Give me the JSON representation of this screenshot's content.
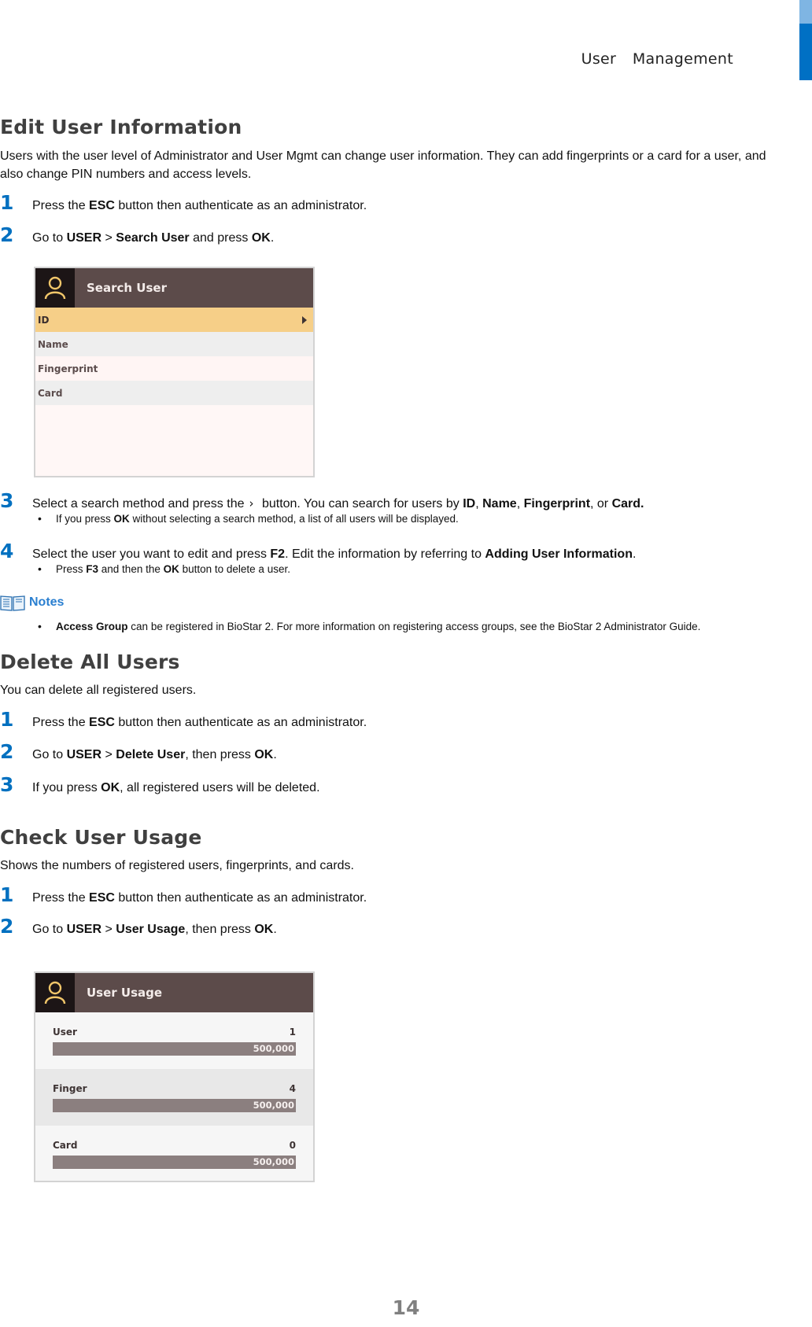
{
  "header": {
    "chapter_title": "User  Management",
    "tab_colors": {
      "light": "#7fb5e3",
      "dark": "#0070c4"
    }
  },
  "colors": {
    "step_number": "#0070c0",
    "heading": "#404040",
    "notes_label": "#2a7fd0"
  },
  "sections": {
    "edit": {
      "title": "Edit User Information",
      "intro_line1": "Users with the user level of Administrator and User Mgmt can change user information. They can add fingerprints or a card for a user, and",
      "intro_line2": "also change PIN numbers and access levels.",
      "steps": [
        {
          "num": "1",
          "pre": "Press the ",
          "b1": "ESC",
          "post": " button then authenticate as an administrator."
        },
        {
          "num": "2",
          "pre": "Go to ",
          "b1": "USER",
          "mid1": " > ",
          "b2": "Search User",
          "mid2": " and press ",
          "b3": "OK",
          "post": "."
        },
        {
          "num": "3",
          "pre": "Select a search method and press the",
          "chevron_icon": "chevron-right-icon",
          "chevron": "›",
          "mid1": " button. You can search for users by ",
          "b1": "ID",
          "c1": ", ",
          "b2": "Name",
          "c2": ", ",
          "b3": "Fingerprint",
          "c3": ", or ",
          "b4": "Card.",
          "bullet": {
            "pre": "If you press ",
            "b1": "OK",
            "post": " without selecting a search method, a list of all users will be displayed."
          }
        },
        {
          "num": "4",
          "pre": "Select the user you want to edit and press ",
          "b1": "F2",
          "mid1": ". Edit the information by referring to ",
          "b2": "Adding User Information",
          "post": ".",
          "bullet": {
            "pre": "Press ",
            "b1": "F3",
            "mid1": " and then the ",
            "b2": "OK",
            "post": " button to delete a user."
          }
        }
      ],
      "notes": {
        "label": "Notes",
        "item": {
          "b1": "Access Group",
          "post": " can be registered in BioStar 2. For more information on registering access groups, see the BioStar 2 Administrator Guide."
        }
      }
    },
    "delete": {
      "title": "Delete All Users",
      "intro": "You can delete all registered users.",
      "steps": [
        {
          "num": "1",
          "pre": "Press the ",
          "b1": "ESC",
          "post": " button then authenticate as an administrator."
        },
        {
          "num": "2",
          "pre": "Go to ",
          "b1": "USER",
          "mid1": " > ",
          "b2": "Delete User",
          "mid2": ", then press ",
          "b3": "OK",
          "post": "."
        },
        {
          "num": "3",
          "pre": "If you press ",
          "b1": "OK",
          "post": ", all registered users will be deleted."
        }
      ]
    },
    "usage": {
      "title": "Check User Usage",
      "intro": "Shows the numbers of registered users, fingerprints, and cards.",
      "steps": [
        {
          "num": "1",
          "pre": "Press the ",
          "b1": "ESC",
          "post": " button then authenticate as an administrator."
        },
        {
          "num": "2",
          "pre": "Go to ",
          "b1": "USER",
          "mid1": " > ",
          "b2": "User Usage",
          "mid2": ", then press ",
          "b3": "OK",
          "post": "."
        }
      ]
    }
  },
  "search_user_screen": {
    "title": "Search User",
    "icon": "user-icon",
    "items": [
      {
        "label": "ID",
        "selected": true
      },
      {
        "label": "Name",
        "selected": false
      },
      {
        "label": "Fingerprint",
        "selected": false
      },
      {
        "label": "Card",
        "selected": false
      }
    ],
    "colors": {
      "header": "#5c4b4a",
      "avatar_bg": "#1c1516",
      "selected": "#f6cf88",
      "icon": "#f1c66a"
    }
  },
  "user_usage_screen": {
    "title": "User Usage",
    "icon": "user-icon",
    "rows": [
      {
        "label": "User",
        "count": "1",
        "capacity": "500,000",
        "used_fraction": 2e-06
      },
      {
        "label": "Finger",
        "count": "4",
        "capacity": "500,000",
        "used_fraction": 8e-06
      },
      {
        "label": "Card",
        "count": "0",
        "capacity": "500,000",
        "used_fraction": 0
      }
    ]
  },
  "footer": {
    "page_number": "14"
  }
}
